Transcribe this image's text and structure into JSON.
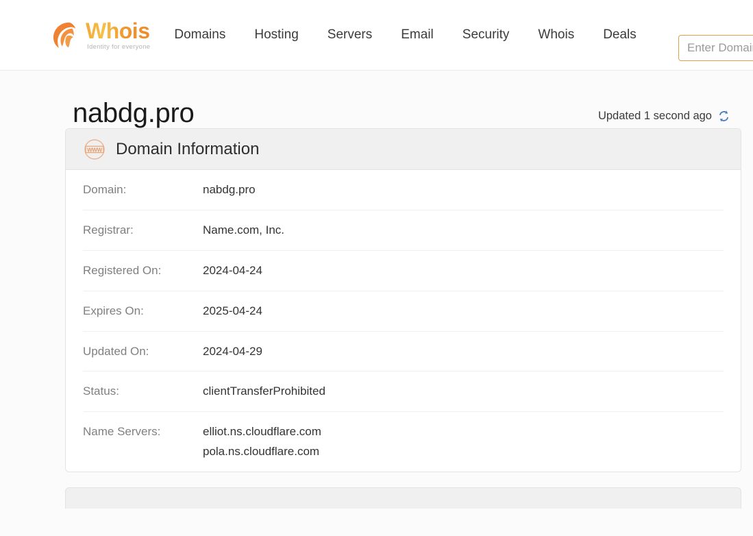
{
  "header": {
    "brand": {
      "word": "Whois",
      "tagline": "Identity for everyone",
      "logo_icon": "whois-swirl-logo",
      "accent_color": "#f2a33a"
    },
    "nav": [
      {
        "label": "Domains"
      },
      {
        "label": "Hosting"
      },
      {
        "label": "Servers"
      },
      {
        "label": "Email"
      },
      {
        "label": "Security"
      },
      {
        "label": "Whois"
      },
      {
        "label": "Deals"
      }
    ],
    "search": {
      "placeholder": "Enter Domain Name",
      "value": "",
      "border_color": "#dba24c"
    }
  },
  "page": {
    "title": "nabdg.pro",
    "updated_text": "Updated 1 second ago",
    "refresh_icon": "refresh-sync-icon",
    "refresh_icon_color": "#4a7ebb"
  },
  "domain_information": {
    "icon": "www-globe-icon",
    "icon_color": "#e8a87c",
    "title": "Domain Information",
    "rows": [
      {
        "label": "Domain:",
        "value": "nabdg.pro"
      },
      {
        "label": "Registrar:",
        "value": "Name.com, Inc."
      },
      {
        "label": "Registered On:",
        "value": "2024-04-24"
      },
      {
        "label": "Expires On:",
        "value": "2025-04-24"
      },
      {
        "label": "Updated On:",
        "value": "2024-04-29"
      },
      {
        "label": "Status:",
        "value": "clientTransferProhibited"
      },
      {
        "label": "Name Servers:",
        "value": "elliot.ns.cloudflare.com\npola.ns.cloudflare.com",
        "name_servers": [
          "elliot.ns.cloudflare.com",
          "pola.ns.cloudflare.com"
        ]
      }
    ]
  }
}
